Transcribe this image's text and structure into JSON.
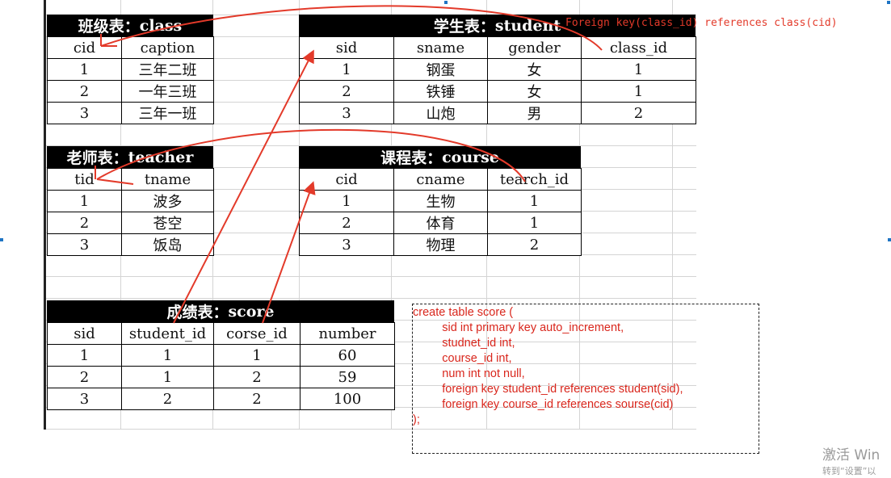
{
  "tables": {
    "class": {
      "title_cn": "班级表：",
      "title_en": "class",
      "headers": [
        "cid",
        "caption"
      ],
      "rows": [
        [
          "1",
          "三年二班"
        ],
        [
          "2",
          "一年三班"
        ],
        [
          "3",
          "三年一班"
        ]
      ]
    },
    "student": {
      "title_cn": "学生表：",
      "title_en": "student",
      "headers": [
        "sid",
        "sname",
        "gender",
        "class_id"
      ],
      "rows": [
        [
          "1",
          "钢蛋",
          "女",
          "1"
        ],
        [
          "2",
          "铁锤",
          "女",
          "1"
        ],
        [
          "3",
          "山炮",
          "男",
          "2"
        ]
      ]
    },
    "teacher": {
      "title_cn": "老师表：",
      "title_en": "teacher",
      "headers": [
        "tid",
        "tname"
      ],
      "rows": [
        [
          "1",
          "波多"
        ],
        [
          "2",
          "苍空"
        ],
        [
          "3",
          "饭岛"
        ]
      ]
    },
    "course": {
      "title_cn": "课程表：",
      "title_en": "course",
      "headers": [
        "cid",
        "cname",
        "tearch_id"
      ],
      "rows": [
        [
          "1",
          "生物",
          "1"
        ],
        [
          "2",
          "体育",
          "1"
        ],
        [
          "3",
          "物理",
          "2"
        ]
      ]
    },
    "score": {
      "title_cn": "成绩表：",
      "title_en": "score",
      "headers": [
        "sid",
        "student_id",
        "corse_id",
        "number"
      ],
      "rows": [
        [
          "1",
          "1",
          "1",
          "60"
        ],
        [
          "2",
          "1",
          "2",
          "59"
        ],
        [
          "3",
          "2",
          "2",
          "100"
        ]
      ]
    }
  },
  "annotations": {
    "fk_note": "Foreign key(class_id) references class(cid)",
    "sql_lines": [
      "create table score (",
      "      sid  int primary key auto_increment,",
      "      studnet_id int,",
      "      course_id int,",
      "      num int not null,",
      "      foreign key student_id references student(sid),",
      "      foreign key course_id references sourse(cid)",
      ");"
    ],
    "annotation_color": "#e33a2a"
  },
  "watermark": {
    "line1": "激活 Win",
    "line2": "转到“设置”以"
  }
}
